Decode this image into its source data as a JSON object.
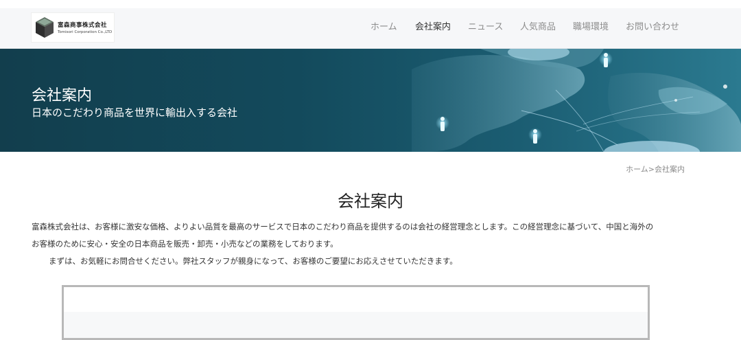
{
  "header": {
    "logo": {
      "name_jp": "富森商事株式会社",
      "name_en": "Tomisori Corporation Co.,LTD"
    },
    "nav": [
      {
        "label": "ホーム",
        "active": false
      },
      {
        "label": "会社案内",
        "active": true
      },
      {
        "label": "ニュース",
        "active": false
      },
      {
        "label": "人気商品",
        "active": false
      },
      {
        "label": "職場環境",
        "active": false
      },
      {
        "label": "お問い合わせ",
        "active": false
      }
    ]
  },
  "banner": {
    "title": "会社案内",
    "subtitle": "日本のこだわり商品を世界に輸出入する会社"
  },
  "breadcrumb": {
    "home": "ホーム",
    "separator": ">",
    "current": "会社案内"
  },
  "main": {
    "title": "会社案内",
    "paragraphs": [
      "富森株式会社は、お客様に激安な価格、よりよい品質を最高のサービスで日本のこだわり商品を提供するのは会社の経営理念とします。この経営理念に基づいて、中国と海外の",
      "お客様のために安心・安全の日本商品を販売・卸売・小売などの業務をしております。",
      "まずは、お気軽にお問合せください。弊社スタッフが親身になって、お客様のご要望にお応えさせていただきます。"
    ]
  },
  "colors": {
    "banner_dark": "#123e4d",
    "banner_light": "#2b7a90",
    "nav_active": "#333333",
    "nav_inactive": "#8c8c8c"
  }
}
